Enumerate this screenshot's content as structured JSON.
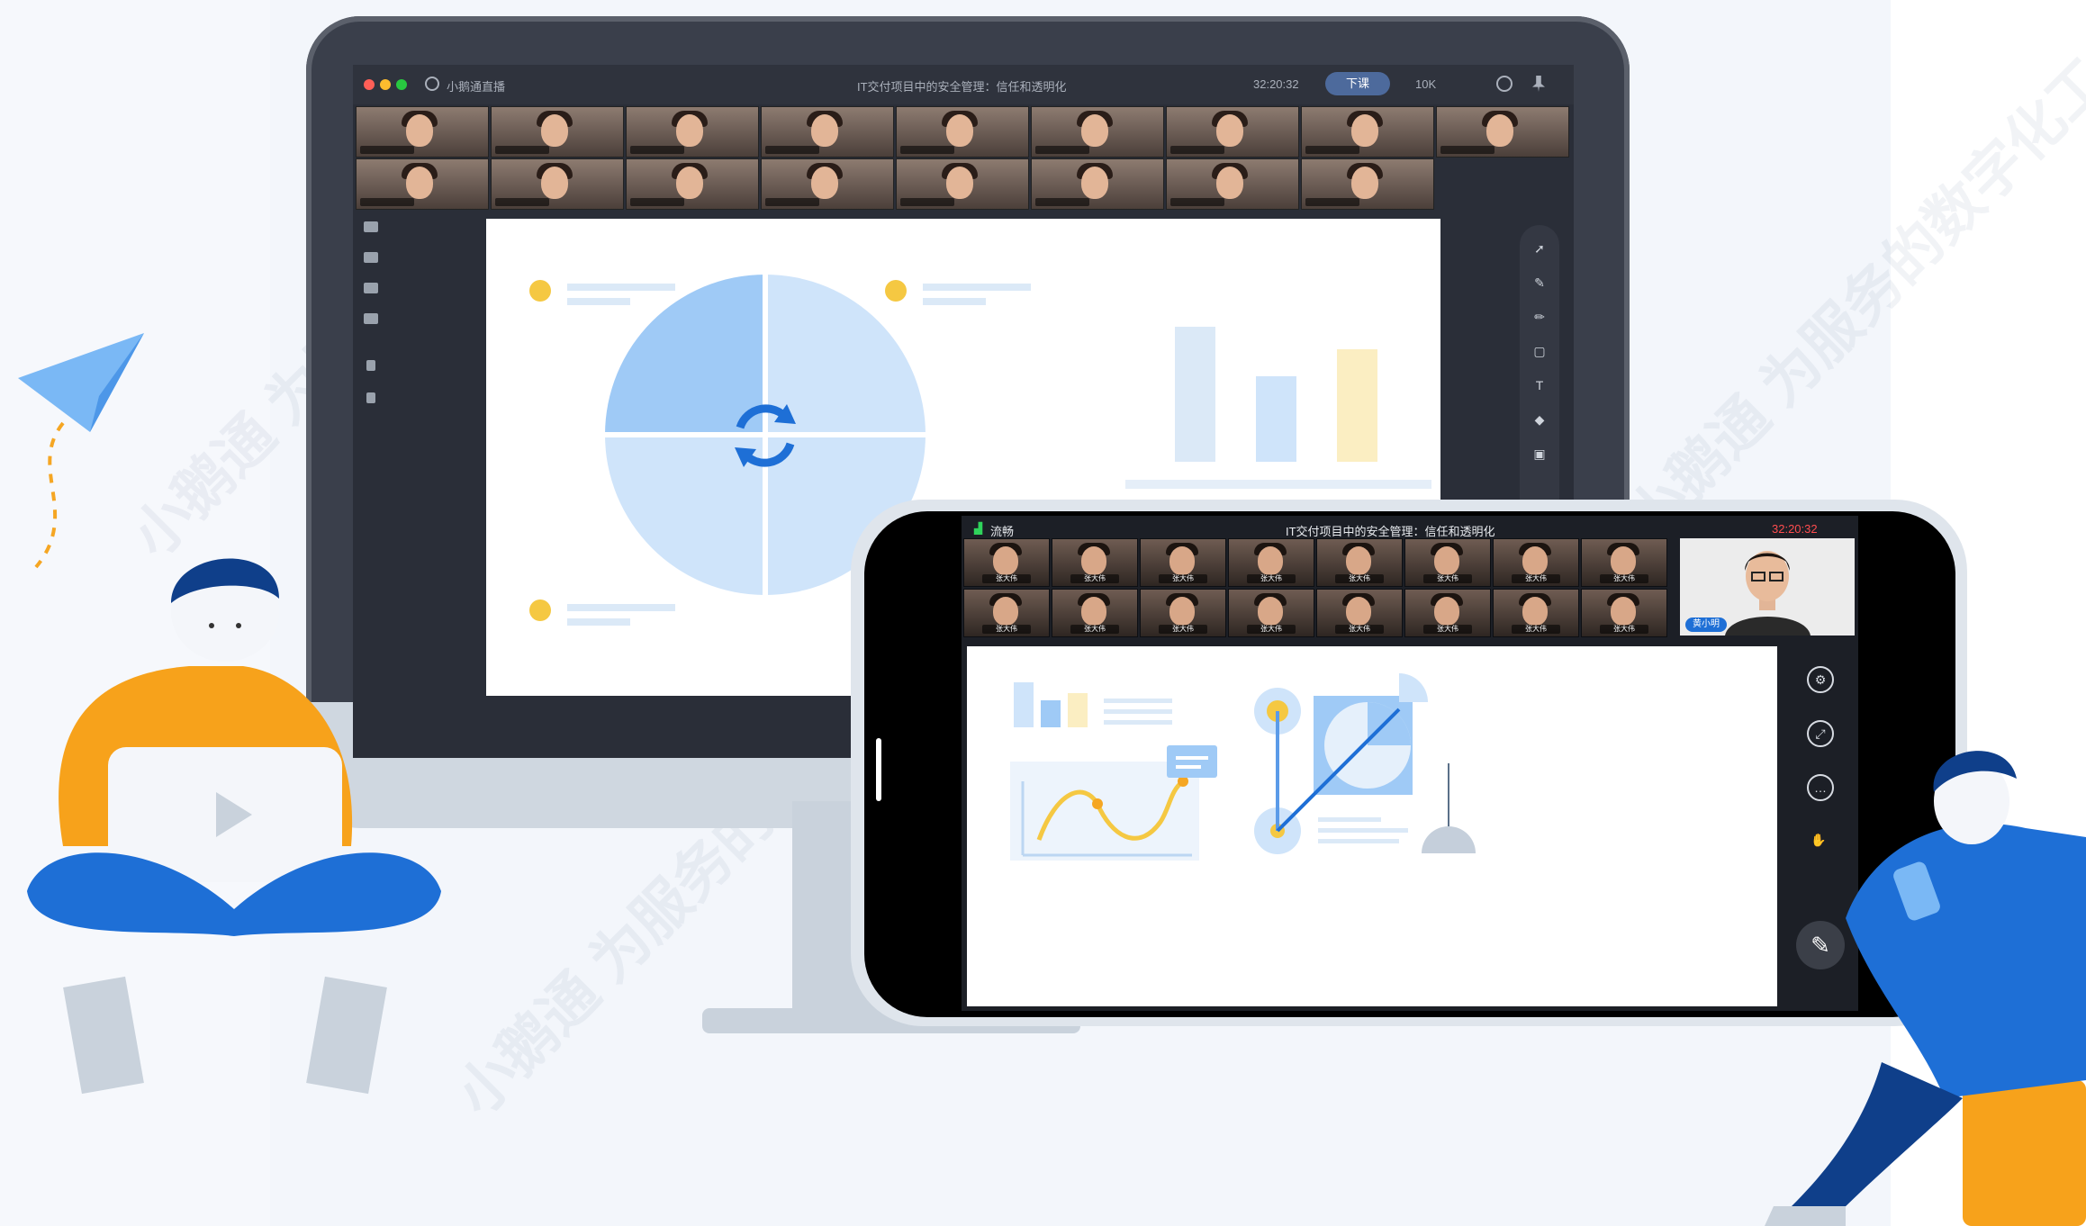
{
  "desktop": {
    "window_title": "IT交付项目中的安全管理：信任和透明化",
    "app_name": "小鹅通直播",
    "timer": "32:20:32",
    "status_pill": "下课",
    "network": "10K"
  },
  "mobile": {
    "signal_label": "流畅",
    "title": "IT交付项目中的安全管理：信任和透明化",
    "timer": "32:20:32",
    "host_name": "黄小明",
    "participant_tags": [
      "张大伟",
      "张大伟",
      "张大伟",
      "张大伟",
      "张大伟",
      "张大伟",
      "张大伟",
      "张大伟",
      "张大伟",
      "张大伟",
      "张大伟",
      "张大伟",
      "张大伟",
      "张大伟",
      "张大伟",
      "张大伟"
    ]
  },
  "watermark": "小鹅通 为服务的数字化工具",
  "colors": {
    "accent_blue": "#7ab8f5",
    "accent_yellow": "#f5c842",
    "orange": "#f7a21b",
    "deep_blue": "#1e6fd6"
  }
}
